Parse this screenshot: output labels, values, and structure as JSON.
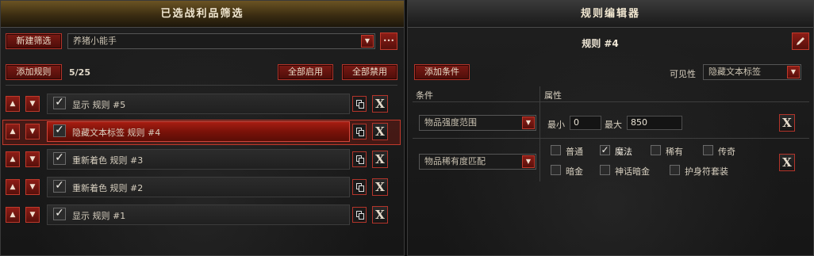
{
  "left": {
    "title": "已选战利品筛选",
    "new_filter_label": "新建筛选",
    "filter_name": "养猪小能手",
    "add_rule_label": "添加规则",
    "rule_count": "5/25",
    "enable_all_label": "全部启用",
    "disable_all_label": "全部禁用",
    "rules": [
      {
        "label": "显示  规则 #5",
        "checked": true,
        "selected": false
      },
      {
        "label": "隐藏文本标签  规则 #4",
        "checked": true,
        "selected": true
      },
      {
        "label": "重新着色  规则 #3",
        "checked": true,
        "selected": false
      },
      {
        "label": "重新着色  规则 #2",
        "checked": true,
        "selected": false
      },
      {
        "label": "显示  规则 #1",
        "checked": true,
        "selected": false
      }
    ]
  },
  "right": {
    "title": "规则编辑器",
    "rule_title": "规则 #4",
    "add_condition_label": "添加条件",
    "visibility_label": "可见性",
    "visibility_value": "隐藏文本标签",
    "col_condition": "条件",
    "col_property": "属性",
    "conditions": [
      {
        "type": "物品强度范围",
        "min_label": "最小",
        "min_value": "0",
        "max_label": "最大",
        "max_value": "850"
      },
      {
        "type": "物品稀有度匹配",
        "rarities": [
          {
            "label": "普通",
            "checked": false
          },
          {
            "label": "魔法",
            "checked": true
          },
          {
            "label": "稀有",
            "checked": false
          },
          {
            "label": "传奇",
            "checked": false
          },
          {
            "label": "暗金",
            "checked": false
          },
          {
            "label": "神话暗金",
            "checked": false
          },
          {
            "label": "护身符套装",
            "checked": false
          }
        ]
      }
    ]
  },
  "icons": {
    "up": "▲",
    "down": "▼",
    "check": "✓",
    "close": "X",
    "more": "•••",
    "dropdown": "▼"
  },
  "colors": {
    "accent_red": "#b3342a",
    "selected_row": "#7a1209",
    "header_gold": "#6b5323"
  }
}
